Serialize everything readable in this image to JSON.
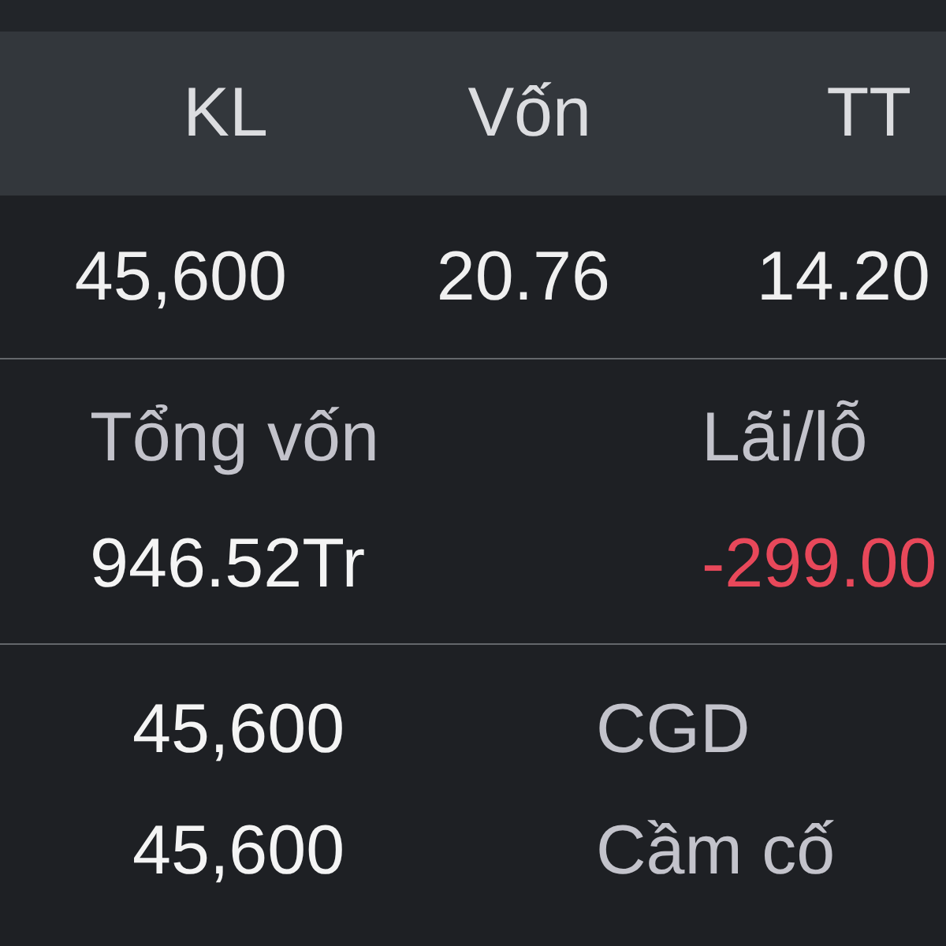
{
  "table": {
    "columns": [
      "KL",
      "Vốn",
      "TT"
    ],
    "rows": [
      [
        "45,600",
        "20.76",
        "14.20"
      ]
    ]
  },
  "summary": [
    {
      "label": "Tổng vốn",
      "value": "946.52Tr",
      "kind": "plain"
    },
    {
      "label": "Lãi/lỗ",
      "value": "-299.00",
      "kind": "loss"
    }
  ],
  "holdings": [
    {
      "amount": "45,600",
      "label": "CGD"
    },
    {
      "amount": "45,600",
      "label": "Cầm cố"
    }
  ]
}
